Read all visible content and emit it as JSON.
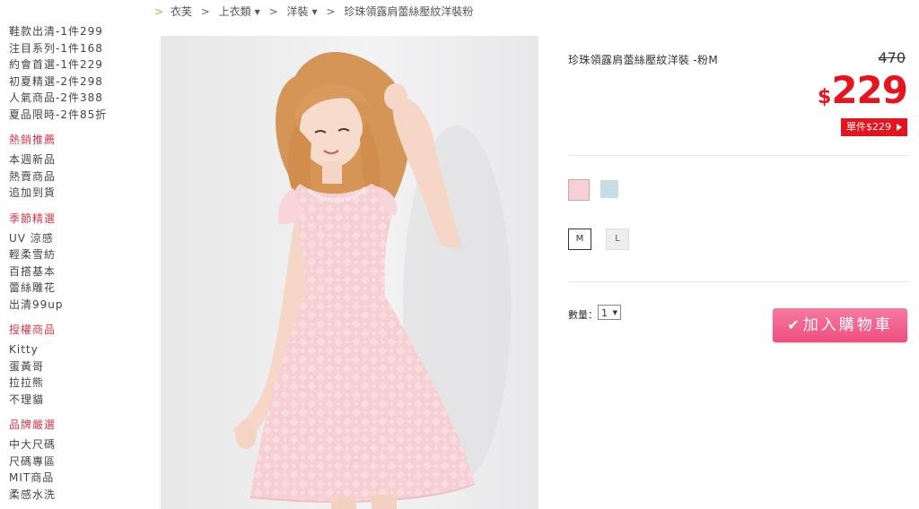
{
  "sidebar": {
    "top_items": [
      "鞋款出清-1件299",
      "注目系列-1件168",
      "約會首選-1件229",
      "初夏精選-2件298",
      "人氣商品-2件388",
      "夏品限時-2件85折"
    ],
    "sections": [
      {
        "heading": "熱銷推薦",
        "items": [
          "本週新品",
          "熱賣商品",
          "追加到貨"
        ]
      },
      {
        "heading": "季節精選",
        "items": [
          "UV 涼感",
          "輕柔雪紡",
          "百搭基本",
          "蕾絲雕花",
          "出清99up"
        ]
      },
      {
        "heading": "授權商品",
        "items": [
          "Kitty",
          "蛋黃哥",
          "拉拉熊",
          "不理貓"
        ]
      },
      {
        "heading": "品牌嚴選",
        "items": [
          "中大尺碼",
          "尺碼專區",
          "MIT商品",
          "柔感水洗"
        ]
      }
    ]
  },
  "breadcrumb": {
    "home_arrow": ">",
    "items": [
      "衣芙",
      "上衣類",
      "洋裝",
      "珍珠領露肩蕾絲壓紋洋裝粉"
    ],
    "separator": ">"
  },
  "product": {
    "title": "珍珠領露肩蕾絲壓紋洋裝 -粉M",
    "original_price": "470",
    "currency_symbol": "$",
    "sale_price": "229",
    "unit_price_label": "單件$229",
    "colors": [
      {
        "name": "pink",
        "hex": "#f7cfd6"
      },
      {
        "name": "light-blue",
        "hex": "#c8dce6"
      }
    ],
    "sizes": [
      "M",
      "L"
    ],
    "selected_size": "M",
    "quantity_label": "數量：",
    "quantity_value": "1",
    "add_to_cart_label": "加入購物車"
  },
  "colors": {
    "accent": "#e6141e",
    "sidebar_heading": "#d9364a",
    "cart_button": "#ee4e80",
    "breadcrumb_arrow": "#e8a13a"
  }
}
